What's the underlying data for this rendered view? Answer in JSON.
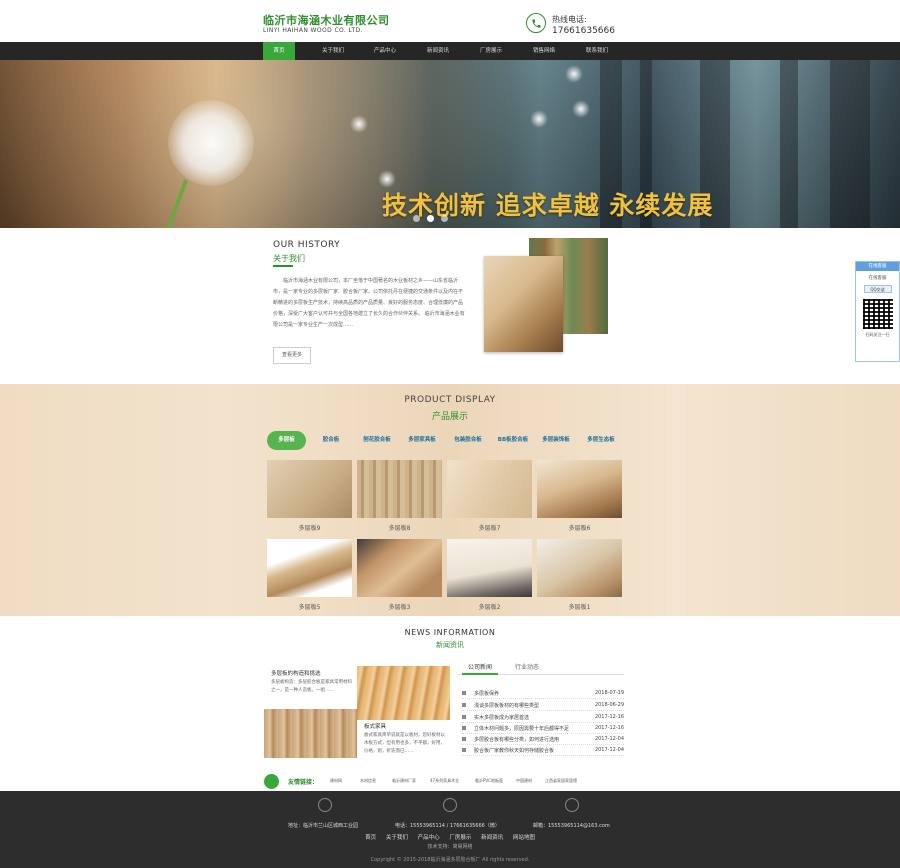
{
  "header": {
    "company_cn": "临沂市海涵木业有限公司",
    "company_en": "LINYI HAIHAN WOOD CO. LTD.",
    "hotline_label": "热线电话:",
    "hotline_number": "17661635666",
    "phone_icon": "phone-icon"
  },
  "nav": {
    "items": [
      "首页",
      "关于我们",
      "产品中心",
      "新闻资讯",
      "厂房展示",
      "销售网络",
      "联系我们"
    ],
    "active_index": 0
  },
  "banner": {
    "slogan": "技术创新 追求卓越 永续发展",
    "dots_count": 3,
    "active_dot": 1
  },
  "history": {
    "title_en": "OUR HISTORY",
    "title_cn": "关于我们",
    "text": "临沂市海涵木业有限公司，本厂坐落于中国著名的木业板材之乡——山东省临沂市，是一家专业的多层板厂家、胶合板厂家。公司依托丹在便捷的交通条件以及内在不断精进的多层板生产技术，持续高品质的产品质量、良好的服务态度、合理低廉的产品价格，深受广大客户认可并与全国各地建立了长久的合作伙伴关系。 临沂市海涵木业有限公司是一家专业生产一次成型……",
    "more_label": "查看更多"
  },
  "products": {
    "title_en": "PRODUCT DISPLAY",
    "title_cn": "产品展示",
    "tabs": [
      "多层板",
      "胶合板",
      "刨花胶合板",
      "多层家具板",
      "包装胶合板",
      "BB板胶合板",
      "多层装饰板",
      "多层生态板"
    ],
    "active_tab": 0,
    "items": [
      "多层板9",
      "多层板8",
      "多层板7",
      "多层板6",
      "多层板5",
      "多层板3",
      "多层板2",
      "多层板1"
    ]
  },
  "news": {
    "title_en": "NEWS INFORMATION",
    "title_cn": "新闻资讯",
    "feature1": {
      "title": "多层板的构造和挑选",
      "text": "多层板构造：多层胶合板是家具常用材料之一，是一种人造板。一组……"
    },
    "feature2": {
      "title": "板式家具",
      "text": "板式家具简单说就是以板材，您好板材以木板方式，但有用也多，不平都，好用，价格，则，折迭而已……"
    },
    "tabs": [
      "公司新闻",
      "行业动态"
    ],
    "active_tab": 0,
    "list": [
      {
        "title": "多层板保养",
        "date": "2018-07-19"
      },
      {
        "title": "浅谈多层板板材的有哪些类型",
        "date": "2018-06-29"
      },
      {
        "title": "实木多层板成为家居首选",
        "date": "2017-12-16"
      },
      {
        "title": "立体木材问题多，原因需要十年后都得不足",
        "date": "2017-12-16"
      },
      {
        "title": "多层胶合板有哪些分类，如何进行选用",
        "date": "2017-12-04"
      },
      {
        "title": "胶合板厂家教你秋天如何存储胶合板",
        "date": "2017-12-04"
      }
    ],
    "links_label": "友情链接：",
    "links": [
      "建材网",
      "木材信息",
      "临沂建材厂家",
      "47系列家具木业",
      "临沂PVC地板面",
      "中国建材",
      "江西省家居家居馆"
    ]
  },
  "footer": {
    "address": "地址：临沂市兰山区城西工业园",
    "phone": "电话：15553965114 / 17661635666（微）",
    "email": "邮箱：15553965114@163.com",
    "links": [
      "首页",
      "关于我们",
      "产品中心",
      "厂房展示",
      "新闻资讯",
      "网站地图"
    ],
    "tech": "技术支持：简易网络",
    "copyright": "Copyright © 2015-2018临沂海涵多层胶合板厂 All rights reserved."
  },
  "side_widget": {
    "header": "在线客服",
    "label": "在线客服",
    "qq": "QQ交谈",
    "scan": "扫码关注一扫"
  },
  "colors": {
    "brand_green": "#2f8f2f",
    "nav_bg": "#262626",
    "footer_bg": "#2d2d2d",
    "slogan_gold": "#f1c13a"
  }
}
